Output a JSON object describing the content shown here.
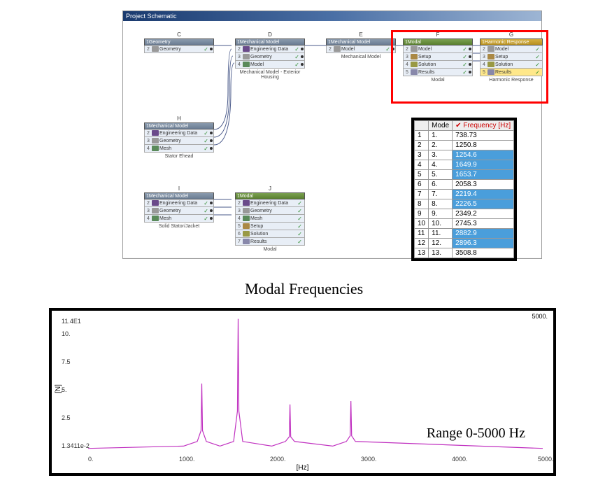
{
  "titlebar": "Project Schematic",
  "blocks": {
    "C": {
      "letter": "C",
      "header": "Geometry",
      "rows": [
        {
          "n": "2",
          "icon": "geo",
          "label": "Geometry"
        }
      ],
      "label": ""
    },
    "D": {
      "letter": "D",
      "header": "Mechanical Model",
      "rows": [
        {
          "n": "2",
          "icon": "eng",
          "label": "Engineering Data"
        },
        {
          "n": "3",
          "icon": "geo",
          "label": "Geometry"
        },
        {
          "n": "4",
          "icon": "mesh",
          "label": "Model"
        }
      ],
      "label": "Mechanical Model - Exterior Housing"
    },
    "E": {
      "letter": "E",
      "header": "Mechanical Model",
      "rows": [
        {
          "n": "2",
          "icon": "geo",
          "label": "Model"
        }
      ],
      "label": "Mechanical Model"
    },
    "F": {
      "letter": "F",
      "header": "Modal",
      "headerClass": "green",
      "rows": [
        {
          "n": "2",
          "icon": "geo",
          "label": "Model"
        },
        {
          "n": "3",
          "icon": "set",
          "label": "Setup"
        },
        {
          "n": "4",
          "icon": "sol",
          "label": "Solution"
        },
        {
          "n": "5",
          "icon": "res",
          "label": "Results"
        }
      ],
      "label": "Modal"
    },
    "G": {
      "letter": "G",
      "header": "Harmonic Response",
      "headerClass": "yellow",
      "rows": [
        {
          "n": "2",
          "icon": "geo",
          "label": "Model"
        },
        {
          "n": "3",
          "icon": "set",
          "label": "Setup"
        },
        {
          "n": "4",
          "icon": "sol",
          "label": "Solution"
        },
        {
          "n": "5",
          "icon": "res",
          "label": "Results"
        }
      ],
      "label": "Harmonic Response"
    },
    "H": {
      "letter": "H",
      "header": "Mechanical Model",
      "rows": [
        {
          "n": "2",
          "icon": "eng",
          "label": "Engineering Data"
        },
        {
          "n": "3",
          "icon": "geo",
          "label": "Geometry"
        },
        {
          "n": "4",
          "icon": "mesh",
          "label": "Mesh"
        }
      ],
      "label": "Stator Ehead"
    },
    "I": {
      "letter": "I",
      "header": "Mechanical Model",
      "rows": [
        {
          "n": "2",
          "icon": "eng",
          "label": "Engineering Data"
        },
        {
          "n": "3",
          "icon": "geo",
          "label": "Geometry"
        },
        {
          "n": "4",
          "icon": "mesh",
          "label": "Mesh"
        }
      ],
      "label": "Solid Stator/Jacket"
    },
    "J": {
      "letter": "J",
      "header": "Modal",
      "headerClass": "green",
      "rows": [
        {
          "n": "2",
          "icon": "eng",
          "label": "Engineering Data"
        },
        {
          "n": "3",
          "icon": "geo",
          "label": "Geometry"
        },
        {
          "n": "4",
          "icon": "mesh",
          "label": "Mesh"
        },
        {
          "n": "5",
          "icon": "set",
          "label": "Setup"
        },
        {
          "n": "6",
          "icon": "sol",
          "label": "Solution"
        },
        {
          "n": "7",
          "icon": "res",
          "label": "Results"
        }
      ],
      "label": "Modal"
    }
  },
  "freq_table": {
    "h1": "Mode",
    "h2": "Frequency [Hz]",
    "rows": [
      {
        "i": "1",
        "m": "1.",
        "v": "738.73",
        "hi": false
      },
      {
        "i": "2",
        "m": "2.",
        "v": "1250.8",
        "hi": false
      },
      {
        "i": "3",
        "m": "3.",
        "v": "1254.6",
        "hi": true
      },
      {
        "i": "4",
        "m": "4.",
        "v": "1649.9",
        "hi": true
      },
      {
        "i": "5",
        "m": "5.",
        "v": "1653.7",
        "hi": true
      },
      {
        "i": "6",
        "m": "6.",
        "v": "2058.3",
        "hi": false
      },
      {
        "i": "7",
        "m": "7.",
        "v": "2219.4",
        "hi": true
      },
      {
        "i": "8",
        "m": "8.",
        "v": "2226.5",
        "hi": true
      },
      {
        "i": "9",
        "m": "9.",
        "v": "2349.2",
        "hi": false
      },
      {
        "i": "10",
        "m": "10.",
        "v": "2745.3",
        "hi": false
      },
      {
        "i": "11",
        "m": "11.",
        "v": "2882.9",
        "hi": true
      },
      {
        "i": "12",
        "m": "12.",
        "v": "2896.3",
        "hi": true
      },
      {
        "i": "13",
        "m": "13.",
        "v": "3508.8",
        "hi": false
      }
    ]
  },
  "label_modal": "Modal Frequencies",
  "chart_data": {
    "type": "line",
    "title": "5000.",
    "xlabel": "[Hz]",
    "ylabel": "[N]",
    "yticks": [
      "11.4E1",
      "10.",
      "7.5",
      "5.",
      "2.5",
      "1.3411e-2"
    ],
    "xticks": [
      "0.",
      "1000.",
      "2000.",
      "3000.",
      "4000.",
      "5000."
    ],
    "range_label": "Range 0-5000 Hz",
    "xlim": [
      0,
      5000
    ],
    "ylim": [
      0,
      11.5
    ],
    "peaks": [
      {
        "x": 1250,
        "y": 5.8
      },
      {
        "x": 1650,
        "y": 11.4
      },
      {
        "x": 2220,
        "y": 4.0
      },
      {
        "x": 2890,
        "y": 4.3
      }
    ],
    "baseline": 0.2
  }
}
